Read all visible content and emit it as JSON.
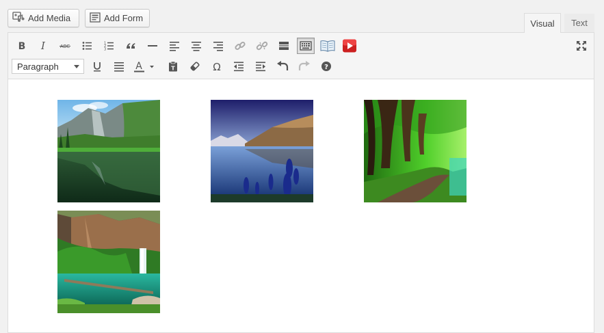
{
  "media_buttons": {
    "add_media_label": "Add Media",
    "add_form_label": "Add Form"
  },
  "tabs": {
    "visual": "Visual",
    "text": "Text",
    "active": "visual"
  },
  "toolbar": {
    "row1": [
      "bold-icon",
      "italic-icon",
      "strikethrough-icon",
      "bullet-list-icon",
      "numbered-list-icon",
      "blockquote-icon",
      "horizontal-rule-icon",
      "align-left-icon",
      "align-center-icon",
      "align-right-icon",
      "link-icon",
      "unlink-icon",
      "read-more-icon",
      "toolbar-toggle-icon",
      "book-icon",
      "youtube-icon",
      "fullscreen-icon"
    ],
    "row2": [
      "underline-icon",
      "justify-icon",
      "text-color-icon",
      "paste-text-icon",
      "clear-formatting-icon",
      "special-character-icon",
      "outdent-icon",
      "indent-icon",
      "undo-icon",
      "redo-icon",
      "help-icon"
    ],
    "format_select": {
      "value": "Paragraph"
    }
  },
  "gallery": {
    "images": [
      {
        "name": "mountain-lake-reflection-image"
      },
      {
        "name": "blue-lake-mountains-image"
      },
      {
        "name": "forest-path-image"
      },
      {
        "name": "waterfall-pool-image"
      }
    ]
  }
}
